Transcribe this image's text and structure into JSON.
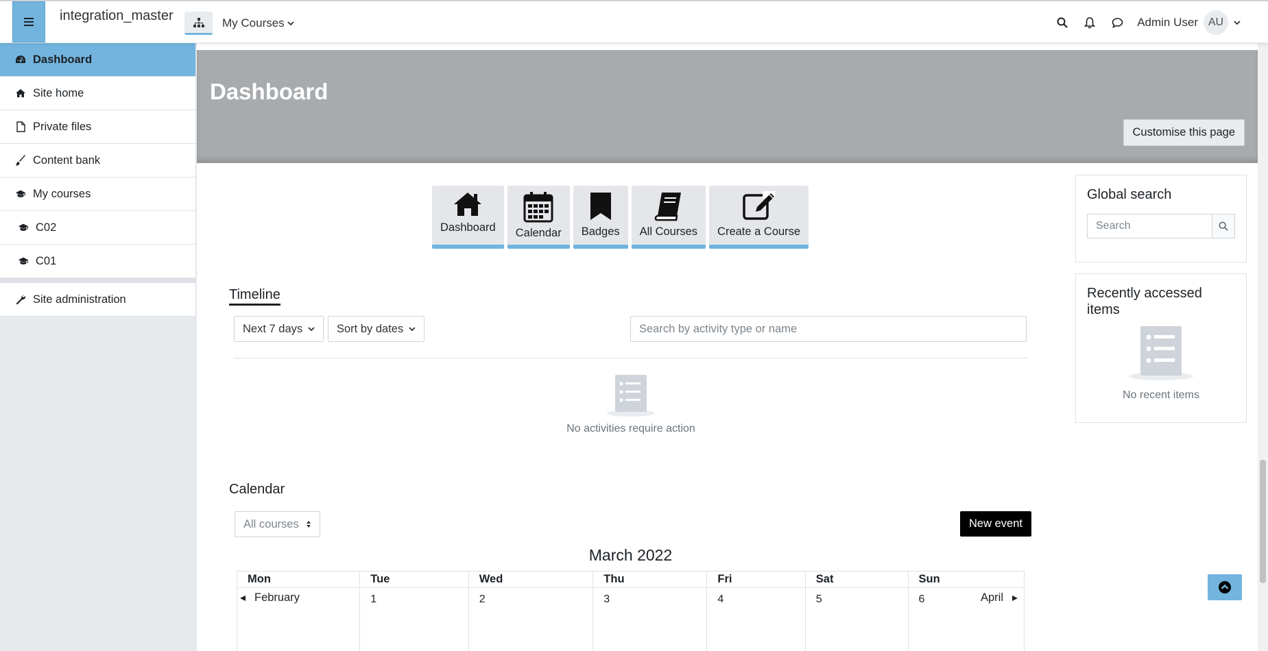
{
  "navbar": {
    "site_name": "integration_master",
    "my_courses": "My Courses",
    "user_name": "Admin User",
    "avatar_initials": "AU",
    "menu_icon": "hamburger-icon"
  },
  "sidebar": {
    "items": [
      {
        "label": "Dashboard",
        "icon": "dashboard-icon",
        "active": true
      },
      {
        "label": "Site home",
        "icon": "home-icon"
      },
      {
        "label": "Private files",
        "icon": "file-icon"
      },
      {
        "label": "Content bank",
        "icon": "brush-icon"
      },
      {
        "label": "My courses",
        "icon": "graduation-cap-icon"
      },
      {
        "label": "C02",
        "icon": "graduation-cap-icon"
      },
      {
        "label": "C01",
        "icon": "graduation-cap-icon"
      },
      {
        "label": "Site administration",
        "icon": "wrench-icon"
      }
    ]
  },
  "header": {
    "title": "Dashboard",
    "customise_label": "Customise this page"
  },
  "quicklinks": [
    {
      "label": "Dashboard",
      "icon": "home-icon"
    },
    {
      "label": "Calendar",
      "icon": "calendar-icon"
    },
    {
      "label": "Badges",
      "icon": "bookmark-icon"
    },
    {
      "label": "All Courses",
      "icon": "book-icon"
    },
    {
      "label": "Create a Course",
      "icon": "edit-icon"
    }
  ],
  "timeline": {
    "title": "Timeline",
    "range_label": "Next 7 days",
    "sort_label": "Sort by dates",
    "search_placeholder": "Search by activity type or name",
    "empty_text": "No activities require action"
  },
  "calendar": {
    "title": "Calendar",
    "course_filter": "All courses",
    "new_event_label": "New event",
    "prev_month": "February",
    "next_month": "April",
    "month_title": "March 2022",
    "weekdays": [
      "Mon",
      "Tue",
      "Wed",
      "Thu",
      "Fri",
      "Sat",
      "Sun"
    ],
    "first_week": [
      "",
      "1",
      "2",
      "3",
      "4",
      "5",
      "6"
    ]
  },
  "global_search": {
    "title": "Global search",
    "placeholder": "Search"
  },
  "recent_items": {
    "title": "Recently accessed items",
    "empty_text": "No recent items"
  },
  "colors": {
    "accent": "#72b4de",
    "header_band": "#a8abae"
  }
}
